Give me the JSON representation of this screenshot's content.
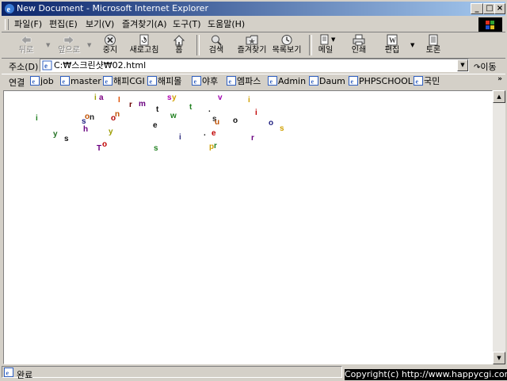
{
  "window": {
    "title": "New Document - Microsoft Internet Explorer"
  },
  "menu": [
    "파일(F)",
    "편집(E)",
    "보기(V)",
    "즐겨찾기(A)",
    "도구(T)",
    "도움말(H)"
  ],
  "toolbar": {
    "back": "뒤로",
    "forward": "앞으로",
    "stop": "중지",
    "refresh": "새로고침",
    "home": "홈",
    "search": "검색",
    "favorites": "즐겨찾기",
    "history": "목록보기",
    "mail": "메일",
    "print": "인쇄",
    "edit": "편집",
    "discuss": "토론"
  },
  "address": {
    "label": "주소(D)",
    "value": "C:₩스크린샷₩02.html",
    "go": "이동"
  },
  "links": {
    "label": "연결",
    "items": [
      "job",
      "master",
      "해피CGI",
      "해피몰",
      "야후",
      "엠파스",
      "Admin",
      "Daum",
      "PHPSCHOOL",
      "국민"
    ]
  },
  "letters": [
    {
      "ch": "i",
      "color": "#9c9c00"
    },
    {
      "ch": "a",
      "color": "#7a0080"
    },
    {
      "ch": "I",
      "color": "#e05000"
    },
    {
      "ch": "r",
      "color": "#6a0000"
    },
    {
      "ch": "m",
      "color": "#6a0080"
    },
    {
      "ch": "s",
      "color": "#b000b0"
    },
    {
      "ch": "y",
      "color": "#d0a000"
    },
    {
      "ch": "v",
      "color": "#a000b0"
    },
    {
      "ch": "i",
      "color": "#d0a000"
    },
    {
      "ch": "t",
      "color": "#101010"
    },
    {
      "ch": "t",
      "color": "#208020"
    },
    {
      "ch": ".",
      "color": "#101010"
    },
    {
      "ch": "w",
      "color": "#208020"
    },
    {
      "ch": "n",
      "color": "#c05000"
    },
    {
      "ch": "i",
      "color": "#c00000"
    },
    {
      "ch": "i",
      "color": "#208020"
    },
    {
      "ch": "o",
      "color": "#c05000"
    },
    {
      "ch": "n",
      "color": "#202020"
    },
    {
      "ch": "s",
      "color": "#202080"
    },
    {
      "ch": "o",
      "color": "#b00000"
    },
    {
      "ch": "s",
      "color": "#202020"
    },
    {
      "ch": "u",
      "color": "#c05000"
    },
    {
      "ch": "o",
      "color": "#101010"
    },
    {
      "ch": "o",
      "color": "#202080"
    },
    {
      "ch": "s",
      "color": "#d0a000"
    },
    {
      "ch": "e",
      "color": "#101010"
    },
    {
      "ch": "h",
      "color": "#6a0080"
    },
    {
      "ch": "y",
      "color": "#9c9c00"
    },
    {
      "ch": "y",
      "color": "#207020"
    },
    {
      "ch": "i",
      "color": "#303080"
    },
    {
      "ch": ".",
      "color": "#101010"
    },
    {
      "ch": "e",
      "color": "#c00000"
    },
    {
      "ch": "r",
      "color": "#6a0080"
    },
    {
      "ch": "s",
      "color": "#101010"
    },
    {
      "ch": "o",
      "color": "#c00000"
    },
    {
      "ch": "T",
      "color": "#6a0080"
    },
    {
      "ch": "s",
      "color": "#208020"
    },
    {
      "ch": "p",
      "color": "#d0a000"
    },
    {
      "ch": "r",
      "color": "#208020"
    }
  ],
  "status": {
    "text": "완료"
  },
  "copyright": "Copyright(c) http://www.happycgi.com"
}
